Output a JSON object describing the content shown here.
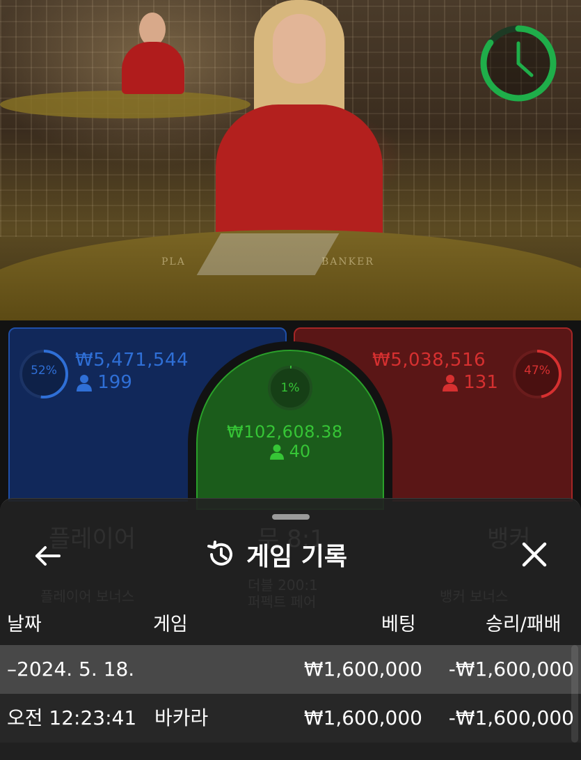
{
  "colors": {
    "player": "#2f6fd6",
    "banker": "#d63030",
    "tie": "#36c536",
    "timer": "#1fae4a",
    "sheet_bg": "#222222"
  },
  "timer": {
    "icon": "clock-icon",
    "remaining_fraction": 0.85
  },
  "video": {
    "felt_player": "PLA",
    "felt_banker": "BANKER"
  },
  "bets": {
    "player": {
      "percent": "52%",
      "percent_value": 0.52,
      "amount": "₩5,471,544",
      "count": "199"
    },
    "banker": {
      "percent": "47%",
      "percent_value": 0.47,
      "amount": "₩5,038,516",
      "count": "131"
    },
    "tie": {
      "percent": "1%",
      "percent_value": 0.01,
      "amount": "₩102,608.38",
      "count": "40"
    }
  },
  "background_labels": {
    "player": "플레이어",
    "tie": "무 8:1",
    "banker": "뱅커",
    "player_bonus": "플레이어 보너스",
    "pair": "더블 200:1\n퍼펙트 페어",
    "banker_bonus": "뱅커 보너스"
  },
  "history": {
    "title": "게임 기록",
    "title_icon": "history-icon",
    "back_icon": "arrow-left-icon",
    "close_icon": "close-icon",
    "columns": {
      "date": "날짜",
      "game": "게임",
      "bet": "베팅",
      "win_loss": "승리/패배"
    },
    "date_row": {
      "date": "–2024. 5. 18.",
      "bet": "₩1,600,000",
      "win_loss": "-₩1,600,000"
    },
    "rows": [
      {
        "time": "오전 12:23:41",
        "game": "바카라",
        "bet": "₩1,600,000",
        "win_loss": "-₩1,600,000"
      }
    ]
  }
}
